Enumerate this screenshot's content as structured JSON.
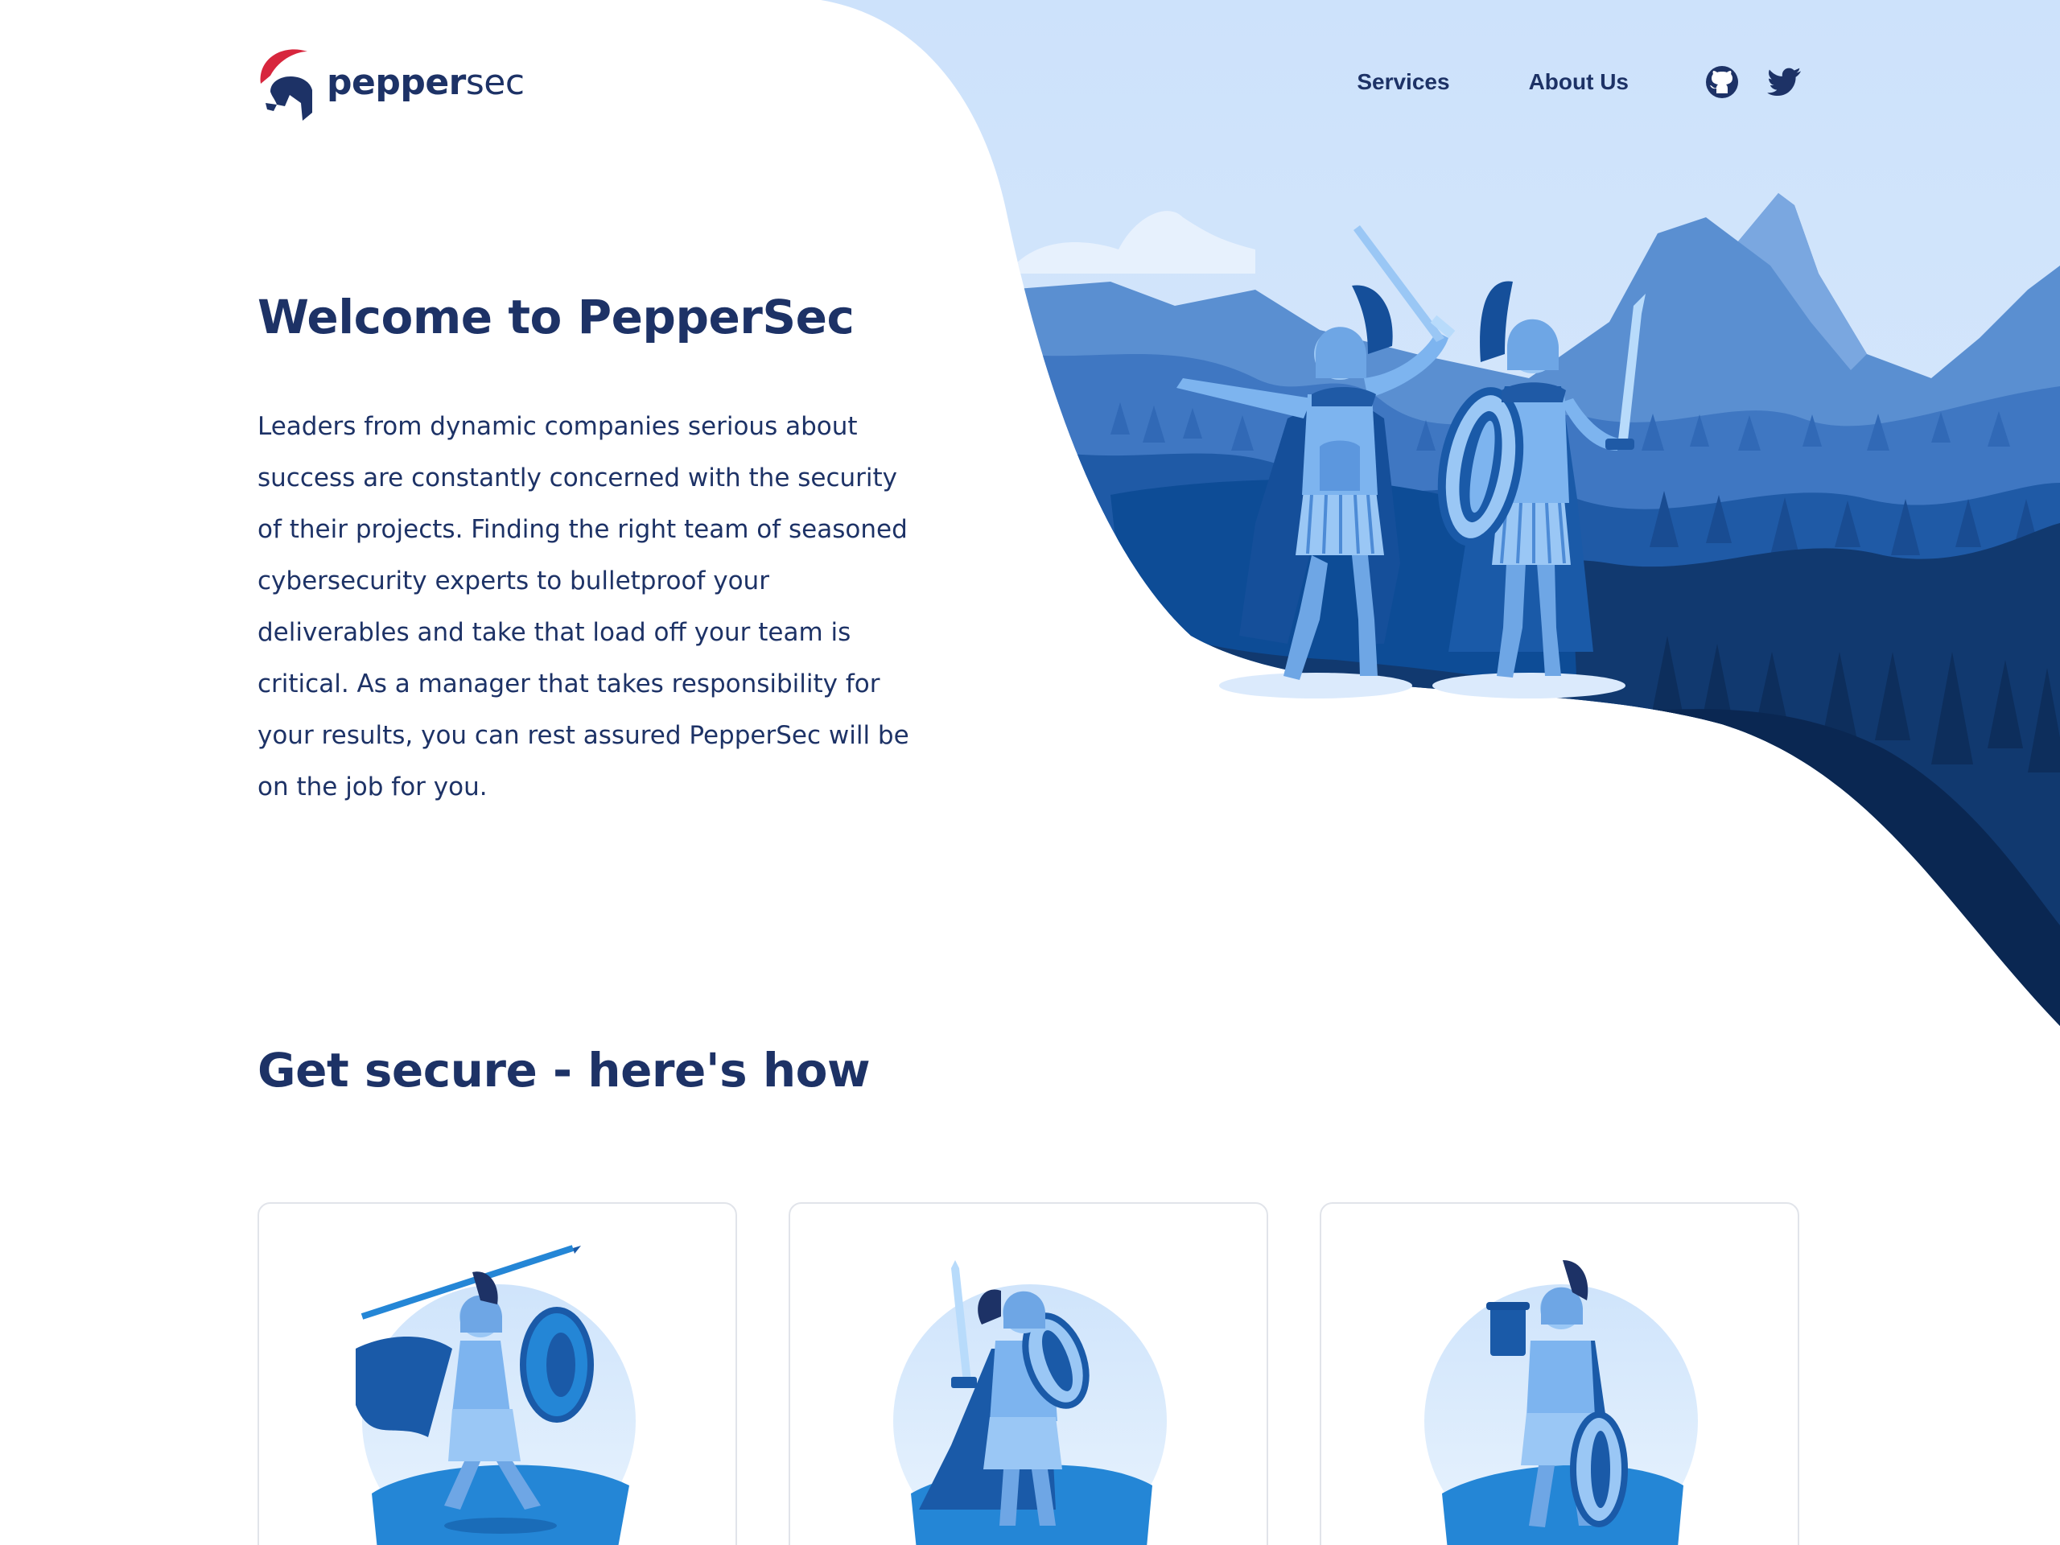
{
  "header": {
    "logo_bold": "pepper",
    "logo_light": "sec",
    "nav": [
      {
        "label": "Services"
      },
      {
        "label": "About Us"
      }
    ],
    "social_icons": [
      "github-icon",
      "twitter-icon"
    ]
  },
  "hero": {
    "title": "Welcome to PepperSec",
    "body": "Leaders from dynamic companies serious about success are constantly concerned with the security of their projects. Finding the right team of seasoned cybersecurity experts to bulletproof your deliverables and take that load off your team is critical. As a manager that takes responsibility for your results, you can rest assured PepperSec will be on the job for you."
  },
  "section": {
    "title": "Get secure - here's how"
  },
  "colors": {
    "navy": "#1d3266",
    "sky": "#cfe4fb",
    "accent_red": "#d7263d",
    "card_border": "#e1e4ea"
  }
}
